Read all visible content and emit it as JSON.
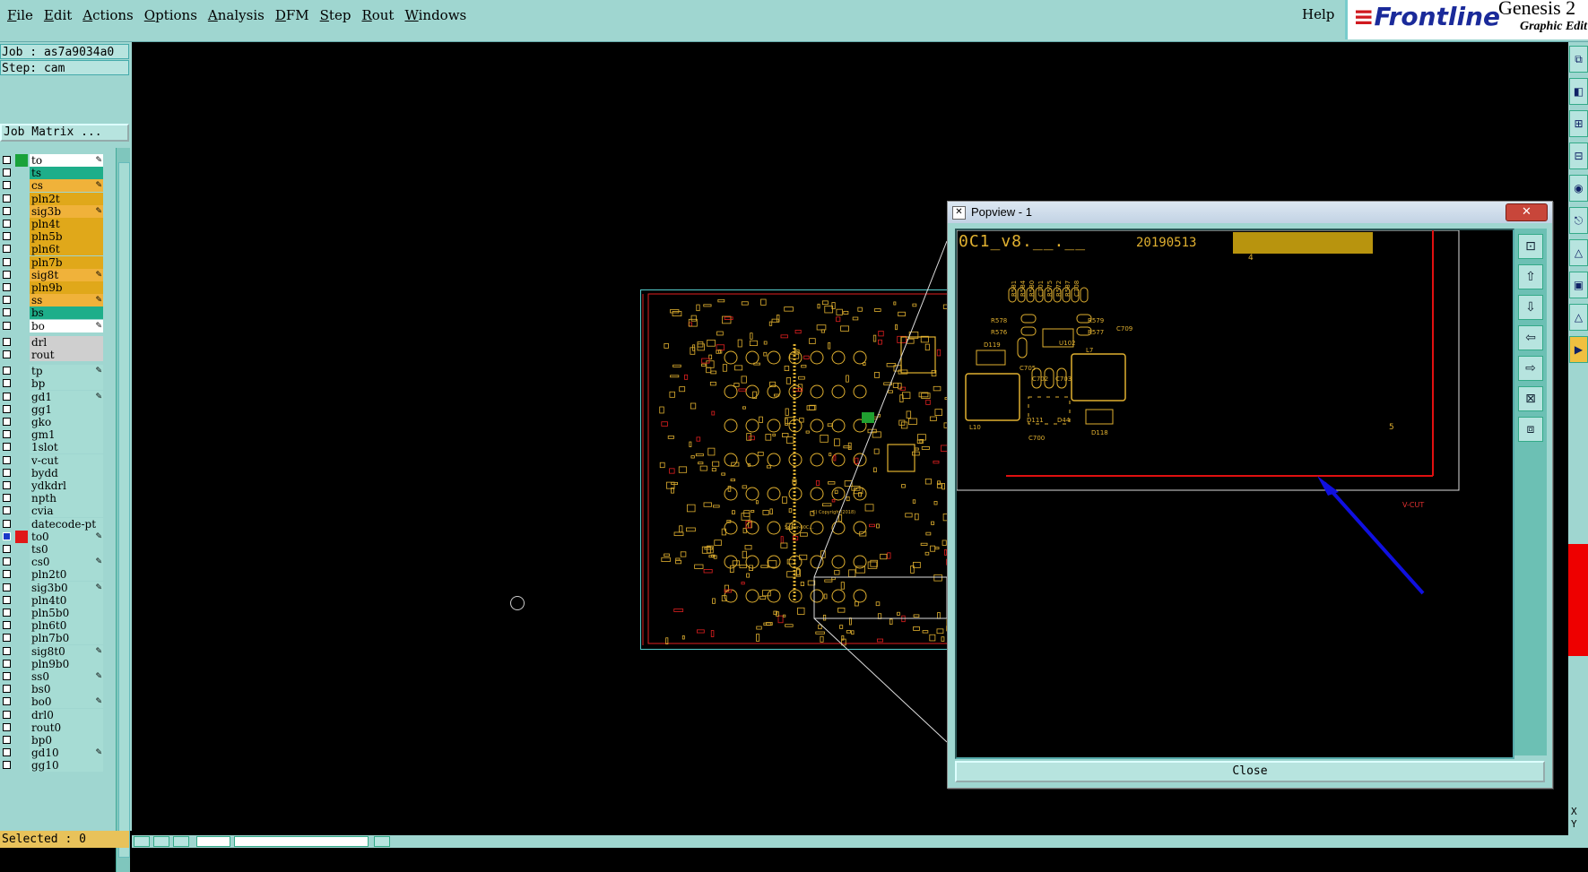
{
  "menu": {
    "items": [
      "File",
      "Edit",
      "Actions",
      "Options",
      "Analysis",
      "DFM",
      "Step",
      "Rout",
      "Windows"
    ],
    "help": "Help"
  },
  "brand": {
    "logo": "Frontline",
    "product": "Genesis 2",
    "subtitle": "Graphic Edit"
  },
  "job": {
    "label": "Job : as7a9034a0",
    "step": "Step: cam",
    "matrix_button": "Job Matrix ..."
  },
  "layers": [
    {
      "name": "to",
      "color": "#ffffff",
      "swatch": "#19a23a",
      "edit": true
    },
    {
      "name": "ts",
      "color": "#1eae8a",
      "swatch": "",
      "edit": false
    },
    {
      "name": "cs",
      "color": "#f0b23a",
      "swatch": "",
      "edit": true
    },
    {
      "name": "pln2t",
      "color": "#e0a81a",
      "swatch": "",
      "edit": false
    },
    {
      "name": "sig3b",
      "color": "#f0b23a",
      "swatch": "",
      "edit": true
    },
    {
      "name": "pln4t",
      "color": "#e0a81a",
      "swatch": "",
      "edit": false
    },
    {
      "name": "pln5b",
      "color": "#e0a81a",
      "swatch": "",
      "edit": false
    },
    {
      "name": "pln6t",
      "color": "#e0a81a",
      "swatch": "",
      "edit": false
    },
    {
      "name": "pln7b",
      "color": "#e0a81a",
      "swatch": "",
      "edit": false
    },
    {
      "name": "sig8t",
      "color": "#f0b23a",
      "swatch": "",
      "edit": true
    },
    {
      "name": "pln9b",
      "color": "#e0a81a",
      "swatch": "",
      "edit": false
    },
    {
      "name": "ss",
      "color": "#f0b23a",
      "swatch": "",
      "edit": true
    },
    {
      "name": "bs",
      "color": "#1eae8a",
      "swatch": "",
      "edit": false
    },
    {
      "name": "bo",
      "color": "#ffffff",
      "swatch": "",
      "edit": true
    },
    {
      "name": "drl",
      "color": "#cfcfcf",
      "swatch": "",
      "edit": false,
      "gap": true
    },
    {
      "name": "rout",
      "color": "#cfcfcf",
      "swatch": "",
      "edit": false
    },
    {
      "name": "tp",
      "color": "#a6dcd4",
      "swatch": "",
      "edit": true,
      "gap": true
    },
    {
      "name": "bp",
      "color": "#a6dcd4",
      "swatch": "",
      "edit": false
    },
    {
      "name": "gd1",
      "color": "#a6dcd4",
      "swatch": "",
      "edit": true
    },
    {
      "name": "gg1",
      "color": "#a6dcd4",
      "swatch": "",
      "edit": false
    },
    {
      "name": "gko",
      "color": "#a6dcd4",
      "swatch": "",
      "edit": false
    },
    {
      "name": "gm1",
      "color": "#a6dcd4",
      "swatch": "",
      "edit": false
    },
    {
      "name": "1slot",
      "color": "#a6dcd4",
      "swatch": "",
      "edit": false
    },
    {
      "name": "v-cut",
      "color": "#a6dcd4",
      "swatch": "",
      "edit": false
    },
    {
      "name": "bydd",
      "color": "#a6dcd4",
      "swatch": "",
      "edit": false
    },
    {
      "name": "ydkdrl",
      "color": "#a6dcd4",
      "swatch": "",
      "edit": false
    },
    {
      "name": "npth",
      "color": "#a6dcd4",
      "swatch": "",
      "edit": false
    },
    {
      "name": "cvia",
      "color": "#a6dcd4",
      "swatch": "",
      "edit": false
    },
    {
      "name": "datecode-pt",
      "color": "#a6dcd4",
      "swatch": "",
      "edit": false
    },
    {
      "name": "to0",
      "color": "#a6dcd4",
      "swatch": "#e01818",
      "edit": true,
      "active": true
    },
    {
      "name": "ts0",
      "color": "#a6dcd4",
      "swatch": "",
      "edit": false
    },
    {
      "name": "cs0",
      "color": "#a6dcd4",
      "swatch": "",
      "edit": true
    },
    {
      "name": "pln2t0",
      "color": "#a6dcd4",
      "swatch": "",
      "edit": false
    },
    {
      "name": "sig3b0",
      "color": "#a6dcd4",
      "swatch": "",
      "edit": true
    },
    {
      "name": "pln4t0",
      "color": "#a6dcd4",
      "swatch": "",
      "edit": false
    },
    {
      "name": "pln5b0",
      "color": "#a6dcd4",
      "swatch": "",
      "edit": false
    },
    {
      "name": "pln6t0",
      "color": "#a6dcd4",
      "swatch": "",
      "edit": false
    },
    {
      "name": "pln7b0",
      "color": "#a6dcd4",
      "swatch": "",
      "edit": false
    },
    {
      "name": "sig8t0",
      "color": "#a6dcd4",
      "swatch": "",
      "edit": true
    },
    {
      "name": "pln9b0",
      "color": "#a6dcd4",
      "swatch": "",
      "edit": false
    },
    {
      "name": "ss0",
      "color": "#a6dcd4",
      "swatch": "",
      "edit": true
    },
    {
      "name": "bs0",
      "color": "#a6dcd4",
      "swatch": "",
      "edit": false
    },
    {
      "name": "bo0",
      "color": "#a6dcd4",
      "swatch": "",
      "edit": true
    },
    {
      "name": "drl0",
      "color": "#a6dcd4",
      "swatch": "",
      "edit": false
    },
    {
      "name": "rout0",
      "color": "#a6dcd4",
      "swatch": "",
      "edit": false
    },
    {
      "name": "bp0",
      "color": "#a6dcd4",
      "swatch": "",
      "edit": false
    },
    {
      "name": "gd10",
      "color": "#a6dcd4",
      "swatch": "",
      "edit": true
    },
    {
      "name": "gg10",
      "color": "#a6dcd4",
      "swatch": "",
      "edit": false
    }
  ],
  "status": {
    "selected": "Selected : 0"
  },
  "board": {
    "copyright": "C) Copyright(2018)",
    "silk_text": "Spider-00C..."
  },
  "popview": {
    "title": "Popview - 1",
    "close_x": "✕",
    "close_label": "Close",
    "part_text": "0C1_v8.__.__",
    "date_code": "20190513",
    "labels": [
      "R581",
      "R584",
      "R580",
      "C701",
      "R575",
      "R572",
      "R587",
      "C708",
      "R578",
      "R579",
      "R576",
      "R577",
      "C709",
      "D119",
      "U102",
      "C705",
      "C702",
      "C703",
      "L7",
      "L10",
      "D111",
      "D44",
      "D118",
      "C700"
    ],
    "marker_4": "4",
    "marker_5": "5",
    "vcut": "V-CUT"
  },
  "rightbar": {
    "x": "X",
    "y": "Y"
  }
}
